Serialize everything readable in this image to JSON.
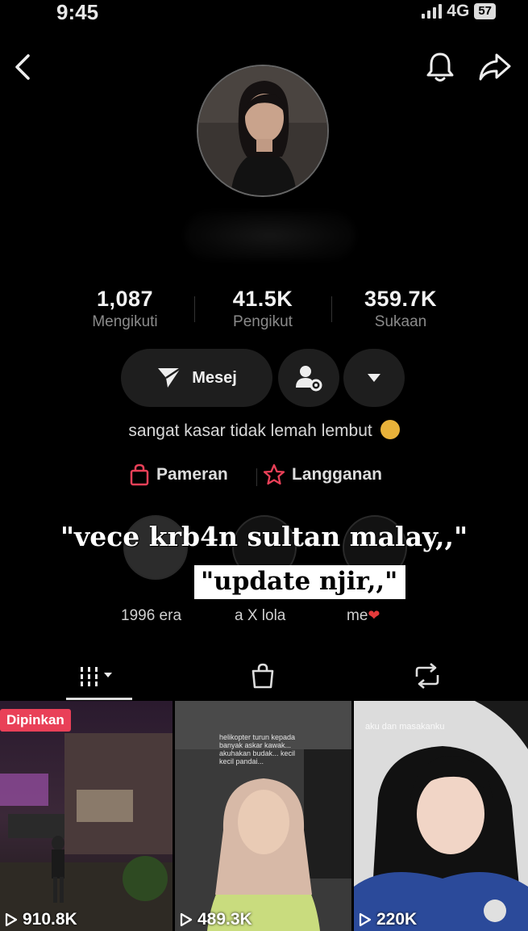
{
  "status_bar": {
    "time": "9:45",
    "network": "4G",
    "battery": "57"
  },
  "profile": {
    "stats": [
      {
        "value": "1,087",
        "label": "Mengikuti"
      },
      {
        "value": "41.5K",
        "label": "Pengikut"
      },
      {
        "value": "359.7K",
        "label": "Sukaan"
      }
    ],
    "message_button": "Mesej",
    "bio": "sangat kasar tidak lemah lembut",
    "links": [
      {
        "label": "Pameran",
        "icon": "shopping-bag-icon"
      },
      {
        "label": "Langganan",
        "icon": "star-badge-icon"
      }
    ],
    "highlights": [
      {
        "label": "1996 era"
      },
      {
        "label": "a X lola"
      },
      {
        "label": "me"
      }
    ]
  },
  "overlay_text": {
    "line1": "\"vece krb4n sultan malay,,\"",
    "line2": "\"update njir,,\""
  },
  "tabs": [
    {
      "name": "videos",
      "icon": "grid-icon"
    },
    {
      "name": "shop",
      "icon": "shopping-bag-icon"
    },
    {
      "name": "reposts",
      "icon": "repost-icon"
    }
  ],
  "videos": [
    {
      "views": "910.8K",
      "badge": "Dipinkan",
      "caption": ""
    },
    {
      "views": "489.3K",
      "badge": "",
      "caption": "helikopter turun kepada banyak askar kawak... akuhakan budak... kecil kecil pandai..."
    },
    {
      "views": "220K",
      "badge": "",
      "caption": "aku dan masakanku"
    }
  ],
  "colors": {
    "accent_red": "#e94058",
    "background": "#000000",
    "button_bg": "#1e1e1e"
  }
}
